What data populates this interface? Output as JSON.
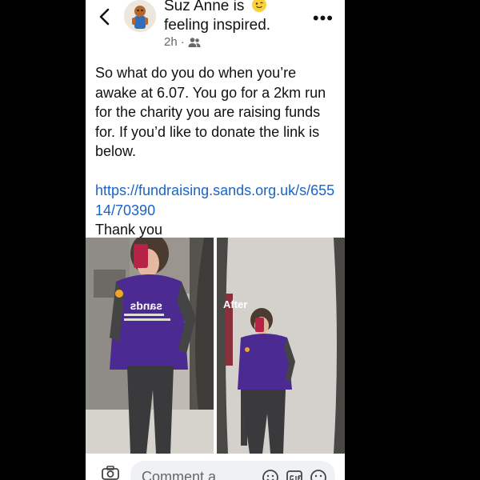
{
  "post": {
    "author": "Suz Anne",
    "is_word": "is",
    "feeling": "feeling inspired.",
    "time": "2h",
    "separator": "·",
    "paragraph1": "So what do you do when you’re awake at 6.07. You go for a 2km run for the charity you are raising funds for. If you’d like to donate the link is below.",
    "link": "https://fundraising.sands.org.uk/s/65514/70390",
    "thanks": "Thank you"
  },
  "photos": {
    "shirt_logo": "sands",
    "after_label": "After"
  },
  "comment": {
    "placeholder": "Comment a"
  },
  "icons": [
    "back-chevron-icon",
    "avatar",
    "feeling-emoji-icon",
    "friends-audience-icon",
    "more-options-icon",
    "camera-icon",
    "avatar-sticker-icon",
    "gif-icon",
    "emoji-icon"
  ]
}
